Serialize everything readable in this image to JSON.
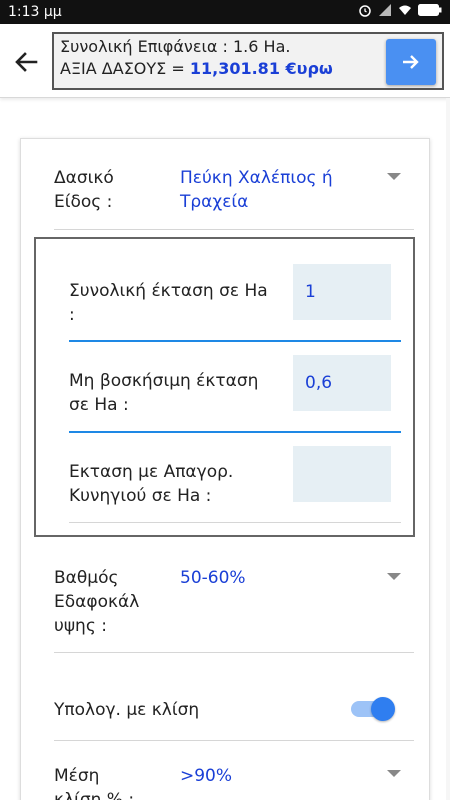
{
  "status_bar": {
    "time": "1:13 μμ"
  },
  "header": {
    "summary_line1": "Συνολική Επιφάνεια : 1.6 Ha.",
    "summary_line2_prefix": "ΑΞΙΑ ΔΑΣΟΥΣ = ",
    "summary_line2_value": "11,301.81 €υρω",
    "go_icon": "arrow-right-icon",
    "back_icon": "arrow-left-icon"
  },
  "form": {
    "species": {
      "label_line1": "Δασικό",
      "label_line2": "Είδος :",
      "value_line1": "Πεύκη Χαλέπιος ή",
      "value_line2": "Τραχεία"
    },
    "areas": {
      "total_label_line1": "Συνολική έκταση σε Ha",
      "total_label_line2": ":",
      "total_value": "1",
      "non_grazing_label_line1": "Μη βοσκήσιμη έκταση",
      "non_grazing_label_line2": "σε Ha :",
      "non_grazing_value": "0,6",
      "hunting_label_line1": "Εκταση με Απαγορ.",
      "hunting_label_line2": "Κυνηγιού σε Ha :",
      "hunting_value": ""
    },
    "coverage": {
      "label_line1": "Βαθμός",
      "label_line2": "Εδαφοκάλ",
      "label_line3": "υψης :",
      "value": "50-60%"
    },
    "slope_toggle": {
      "label": "Υπολογ. με κλίση",
      "on": true
    },
    "mean_slope": {
      "label_line1": "Μέση",
      "label_line2": "κλίση % :",
      "value": ">90%"
    }
  },
  "colors": {
    "accent": "#4a90f2",
    "value_text": "#1a3fd6",
    "divider_blue": "#1e88e5",
    "input_bg": "#e6eff4"
  }
}
